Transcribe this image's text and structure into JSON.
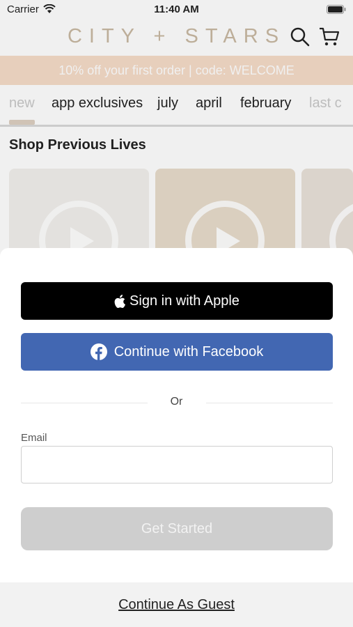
{
  "status_bar": {
    "carrier": "Carrier",
    "time": "11:40 AM"
  },
  "brand": {
    "logo_text": "CITY + STARS",
    "brand_color": "#c9b9a3"
  },
  "promo": {
    "text": "10% off your first order | code: WELCOME",
    "background": "#f6dcc8"
  },
  "categories": {
    "tabs": [
      {
        "label": "new",
        "active": true
      },
      {
        "label": "app exclusives"
      },
      {
        "label": "july"
      },
      {
        "label": "april"
      },
      {
        "label": "february"
      },
      {
        "label": "last c"
      }
    ]
  },
  "section": {
    "title": "Shop Previous Lives"
  },
  "sheet": {
    "apple_button": "Sign in with Apple",
    "facebook_button": "Continue with Facebook",
    "facebook_color": "#4267b2",
    "or_text": "Or",
    "email_label": "Email",
    "email_value": "",
    "get_started": "Get Started",
    "guest_link": "Continue As Guest"
  }
}
